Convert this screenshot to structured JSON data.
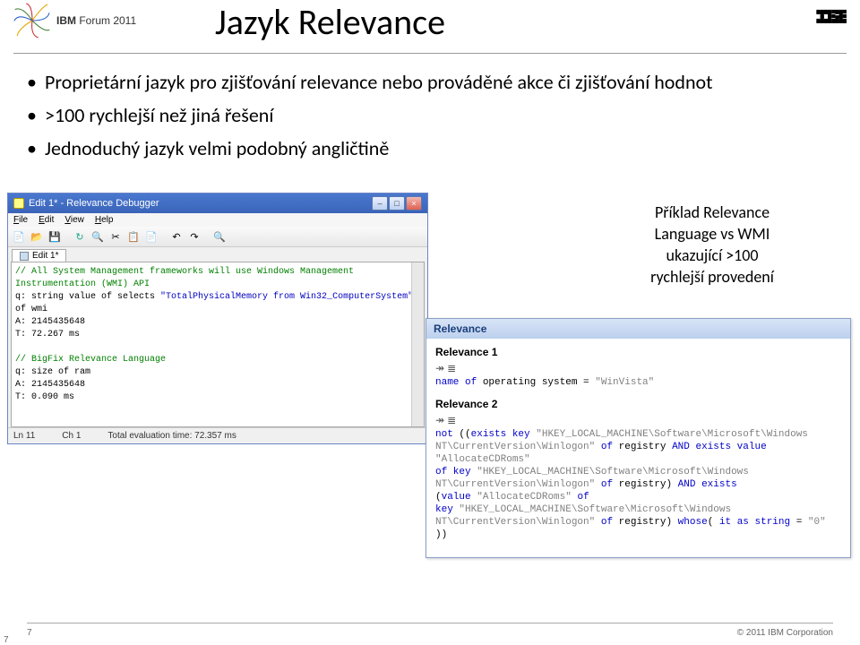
{
  "header": {
    "forum_label": "IBM Forum 2011",
    "title": "Jazyk Relevance"
  },
  "bullets": {
    "b1": "Proprietární jazyk pro zjišťování relevance nebo prováděné akce či zjišťování hodnot",
    "b2": ">100 rychlejší než jiná řešení",
    "b3": "Jednoduchý jazyk velmi podobný angličtině"
  },
  "debugger": {
    "window_title": "Edit 1* - Relevance Debugger",
    "menu": {
      "file": "File",
      "edit": "Edit",
      "view": "View",
      "help": "Help"
    },
    "tab_label": "Edit 1*",
    "code": {
      "l1": "// All System Management frameworks will use Windows Management Instrumentation (WMI) API",
      "l2a": "q: string value of selects ",
      "l2b": "\"TotalPhysicalMemory from Win32_ComputerSystem\"",
      "l2c": " of wmi",
      "l3": "A: 2145435648",
      "l4": "T: 72.267 ms",
      "l6": "// BigFix Relevance Language",
      "l7": "q: size of ram",
      "l8": "A: 2145435648",
      "l9": "T: 0.090 ms"
    },
    "status": {
      "ln": "Ln 11",
      "ch": "Ch 1",
      "eval": "Total evaluation time: 72.357 ms"
    }
  },
  "caption": {
    "line1": "Příklad Relevance",
    "line2": "Language vs WMI",
    "line3": "ukazující >100",
    "line4": "rychlejší provedení"
  },
  "relevance": {
    "panel_title": "Relevance",
    "r1_title": "Relevance 1",
    "r1_code": "name of operating system = \"WinVista\"",
    "r2_title": "Relevance 2",
    "r2_line1": "not ((exists key \"HKEY_LOCAL_MACHINE\\Software\\Microsoft\\Windows",
    "r2_line2": "NT\\CurrentVersion\\Winlogon\" of registry AND exists value \"AllocateCDRoms\"",
    "r2_line3": "of key \"HKEY_LOCAL_MACHINE\\Software\\Microsoft\\Windows",
    "r2_line4": "NT\\CurrentVersion\\Winlogon\" of registry) AND exists",
    "r2_line5": "(value \"AllocateCDRoms\" of",
    "r2_line6": "key \"HKEY_LOCAL_MACHINE\\Software\\Microsoft\\Windows",
    "r2_line7": "NT\\CurrentVersion\\Winlogon\" of registry) whose( it as string = \"0\" ))"
  },
  "footer": {
    "page": "7",
    "copyright": "© 2011 IBM Corporation",
    "page2": "7"
  }
}
